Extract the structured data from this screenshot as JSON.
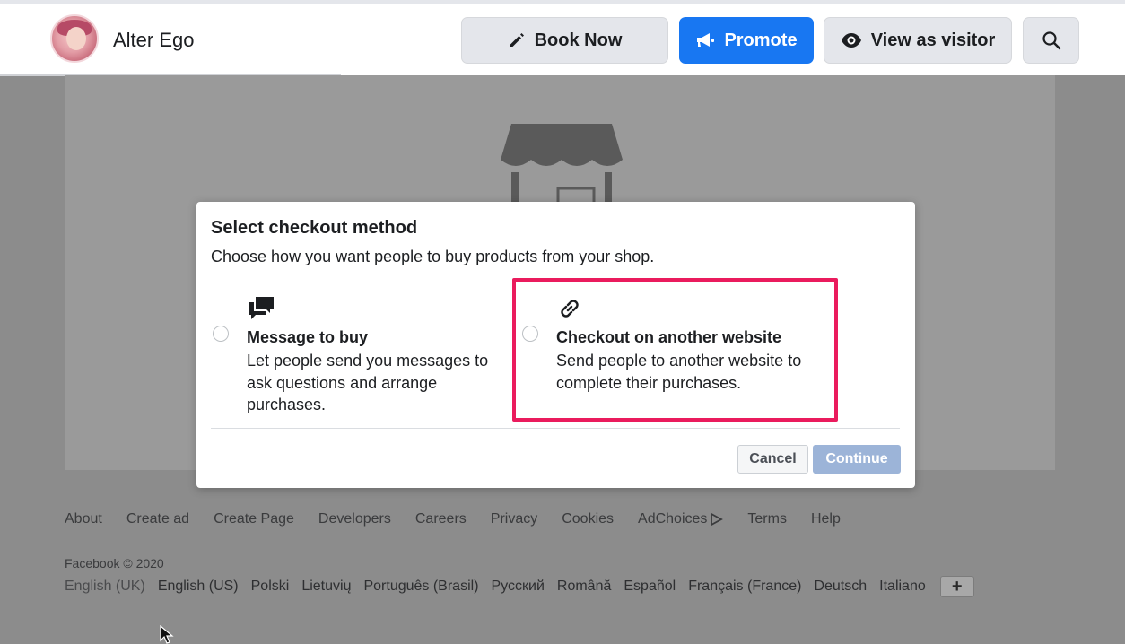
{
  "header": {
    "page_name": "Alter Ego",
    "buttons": {
      "book_now": "Book Now",
      "promote": "Promote",
      "view_as_visitor": "View as visitor"
    },
    "accent_color": "#1877f2"
  },
  "modal": {
    "title": "Select checkout method",
    "subtitle": "Choose how you want people to buy products from your shop.",
    "options": [
      {
        "icon": "message-bubbles-icon",
        "title": "Message to buy",
        "description": "Let people send you messages to ask questions and arrange purchases.",
        "selected": false
      },
      {
        "icon": "link-icon",
        "title": "Checkout on another website",
        "description": "Send people to another website to complete their purchases.",
        "selected": false,
        "highlighted": true
      }
    ],
    "cancel_label": "Cancel",
    "continue_label": "Continue",
    "highlight_color": "#ea1b5d"
  },
  "footer": {
    "links": [
      "About",
      "Create ad",
      "Create Page",
      "Developers",
      "Careers",
      "Privacy",
      "Cookies",
      "AdChoices",
      "Terms",
      "Help"
    ],
    "copyright": "Facebook © 2020",
    "languages": [
      "English (UK)",
      "English (US)",
      "Polski",
      "Lietuvių",
      "Português (Brasil)",
      "Русский",
      "Română",
      "Español",
      "Français (France)",
      "Deutsch",
      "Italiano"
    ],
    "more_languages": "+"
  }
}
